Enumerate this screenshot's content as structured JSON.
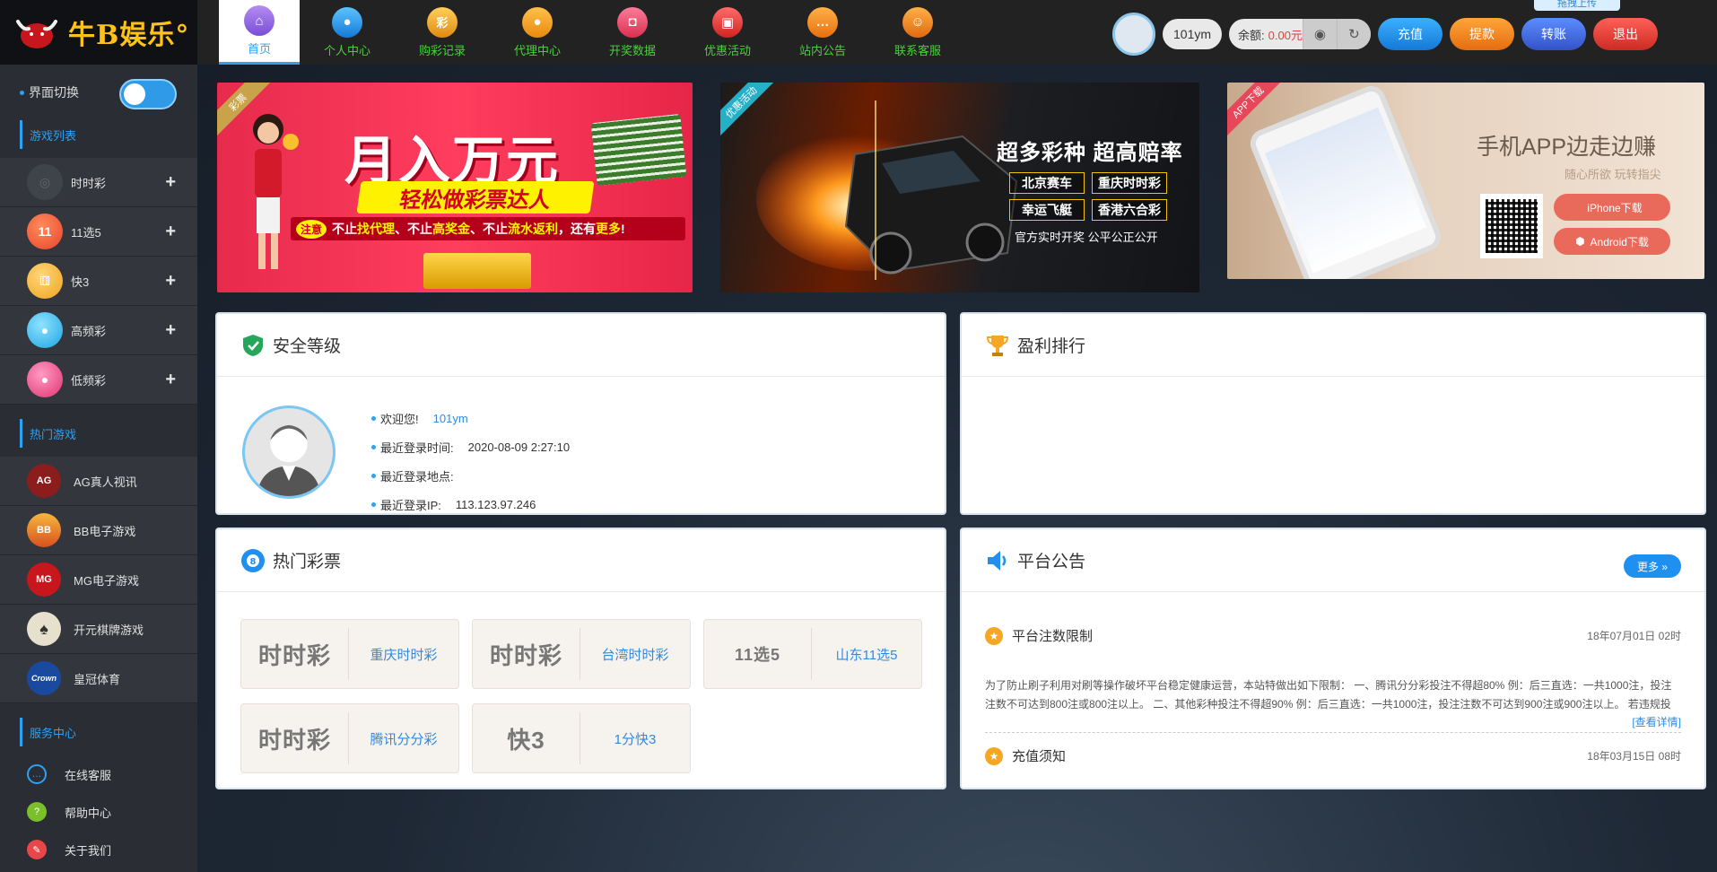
{
  "brand": {
    "name": "牛B娱乐°"
  },
  "sidebar": {
    "switch_label": "界面切换",
    "game_section": "游戏列表",
    "games": [
      {
        "label": "时时彩",
        "icon": "lottery-icon"
      },
      {
        "label": "11选5",
        "icon": "lottery-11x5-icon"
      },
      {
        "label": "快3",
        "icon": "dice-icon"
      },
      {
        "label": "高频彩",
        "icon": "balls-icon"
      },
      {
        "label": "低频彩",
        "icon": "balls-pink-icon"
      }
    ],
    "hot_section": "热门游戏",
    "hot_games": [
      {
        "label": "AG真人视讯",
        "icon": "ag-icon",
        "badge": "AG"
      },
      {
        "label": "BB电子游戏",
        "icon": "bb-icon",
        "badge": "BB"
      },
      {
        "label": "MG电子游戏",
        "icon": "mg-icon",
        "badge": "MG"
      },
      {
        "label": "开元棋牌游戏",
        "icon": "cards-icon",
        "badge": "♠"
      },
      {
        "label": "皇冠体育",
        "icon": "crown-icon",
        "badge": "Crown"
      }
    ],
    "service_section": "服务中心",
    "services": [
      {
        "label": "在线客服",
        "icon": "chat-icon"
      },
      {
        "label": "帮助中心",
        "icon": "help-icon"
      },
      {
        "label": "关于我们",
        "icon": "about-icon"
      }
    ]
  },
  "nav": [
    {
      "label": "首页",
      "icon": "home-icon",
      "glyph": "⌂"
    },
    {
      "label": "个人中心",
      "icon": "user-icon",
      "glyph": "●"
    },
    {
      "label": "购彩记录",
      "icon": "lottery-record-icon",
      "glyph": "彩"
    },
    {
      "label": "代理中心",
      "icon": "agent-icon",
      "glyph": "●"
    },
    {
      "label": "开奖数据",
      "icon": "draw-data-icon",
      "glyph": "◘"
    },
    {
      "label": "优惠活动",
      "icon": "gift-icon",
      "glyph": "▣"
    },
    {
      "label": "站内公告",
      "icon": "message-icon",
      "glyph": "…"
    },
    {
      "label": "联系客服",
      "icon": "headset-icon",
      "glyph": "☺"
    }
  ],
  "user": {
    "username": "101ym",
    "balance_label": "余额:",
    "balance_value": "0.00元",
    "buttons": {
      "deposit": "充值",
      "withdraw": "提款",
      "transfer": "转账",
      "logout": "退出"
    },
    "upload_tag": "拖拽上传"
  },
  "banners": [
    {
      "ribbon": "彩票",
      "headline": "月入万元",
      "sub": "轻松做彩票达人",
      "note_label": "注意",
      "line_parts": [
        "不止",
        "找代理",
        "、不止",
        "高奖金",
        "、不止",
        "流水返利",
        "，还有",
        "更多",
        "!"
      ]
    },
    {
      "ribbon": "优惠活动",
      "headline": "超多彩种  超高赔率",
      "tags": [
        "北京赛车",
        "重庆时时彩",
        "幸运飞艇",
        "香港六合彩"
      ],
      "footer": "官方实时开奖  公平公正公开"
    },
    {
      "ribbon": "APP下载",
      "headline": "手机APP边走边赚",
      "sub": "随心所欲  玩转指尖",
      "ios": "iPhone下载",
      "android": "Android下载"
    }
  ],
  "security": {
    "title": "安全等级",
    "welcome_label": "欢迎您!",
    "welcome_user": "101ym",
    "last_login_time_label": "最近登录时间:",
    "last_login_time": "2020-08-09 2:27:10",
    "last_login_place_label": "最近登录地点:",
    "last_login_ip_label": "最近登录IP:",
    "last_login_ip": "113.123.97.246"
  },
  "ranking": {
    "title": "盈利排行"
  },
  "hot_lottery": {
    "title": "热门彩票",
    "items": [
      {
        "logo": "时时彩",
        "name": "重庆时时彩"
      },
      {
        "logo": "时时彩",
        "name": "台湾时时彩"
      },
      {
        "logo": "11选5",
        "name": "山东11选5"
      },
      {
        "logo": "时时彩",
        "name": "腾讯分分彩"
      },
      {
        "logo": "快3",
        "name": "1分快3"
      }
    ]
  },
  "notice": {
    "title": "平台公告",
    "more": "更多 »",
    "items": [
      {
        "title": "平台注数限制",
        "date": "18年07月01日 02时",
        "body": "为了防止刷子利用对刷等操作破坏平台稳定健康运营，本站特做出如下限制：  一、腾讯分分彩投注不得超80% 例：后三直选：一共1000注，投注注数不可达到800注或800注以上。  二、其他彩种投注不得超90% 例：后三直选：一共1000注，投注注数不可达到900注或900注以上。  若违规投",
        "link": "[查看详情]"
      },
      {
        "title": "充值须知",
        "date": "18年03月15日 08时"
      }
    ]
  },
  "colors": {
    "accent": "#2ea1f2",
    "sidebar": "#2a2d33",
    "nav_text": "#49d13c"
  }
}
